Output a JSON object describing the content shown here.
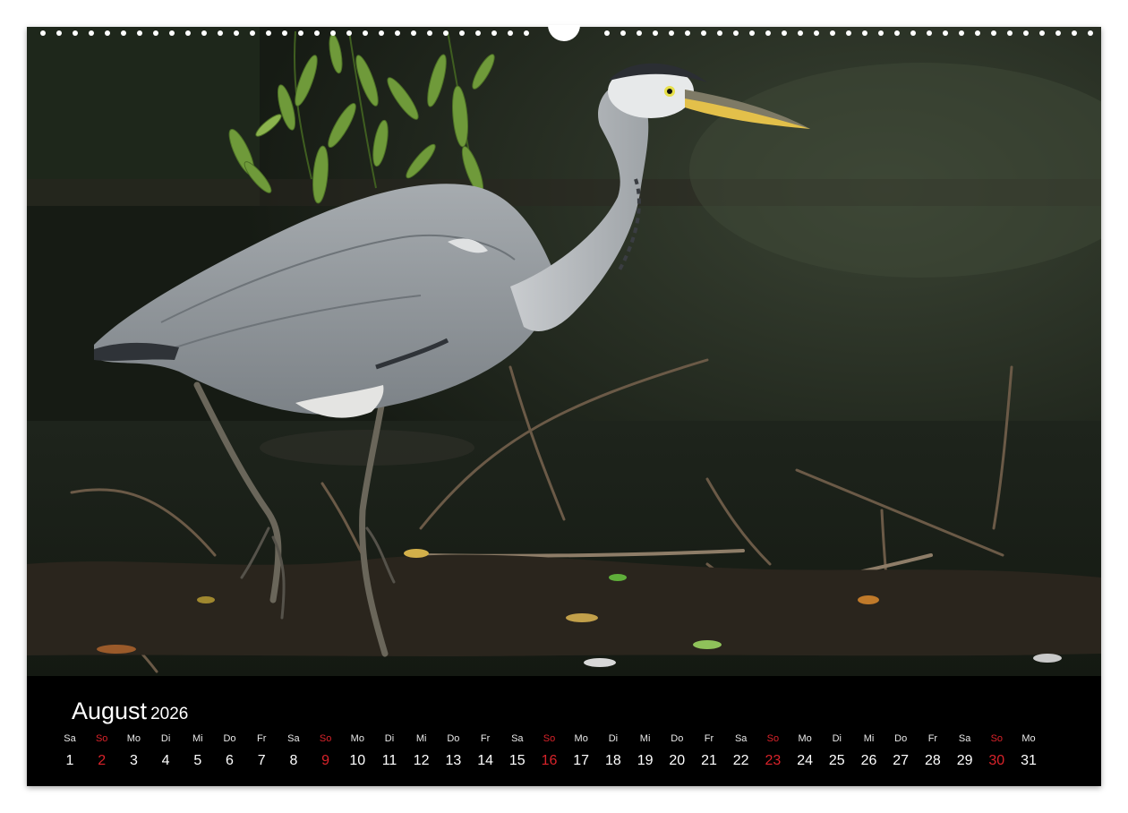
{
  "calendar": {
    "month": "August",
    "year": "2026",
    "weekend_color": "#d9232a",
    "days": [
      {
        "name": "Sa",
        "num": "1",
        "sunday": false
      },
      {
        "name": "So",
        "num": "2",
        "sunday": true
      },
      {
        "name": "Mo",
        "num": "3",
        "sunday": false
      },
      {
        "name": "Di",
        "num": "4",
        "sunday": false
      },
      {
        "name": "Mi",
        "num": "5",
        "sunday": false
      },
      {
        "name": "Do",
        "num": "6",
        "sunday": false
      },
      {
        "name": "Fr",
        "num": "7",
        "sunday": false
      },
      {
        "name": "Sa",
        "num": "8",
        "sunday": false
      },
      {
        "name": "So",
        "num": "9",
        "sunday": true
      },
      {
        "name": "Mo",
        "num": "10",
        "sunday": false
      },
      {
        "name": "Di",
        "num": "11",
        "sunday": false
      },
      {
        "name": "Mi",
        "num": "12",
        "sunday": false
      },
      {
        "name": "Do",
        "num": "13",
        "sunday": false
      },
      {
        "name": "Fr",
        "num": "14",
        "sunday": false
      },
      {
        "name": "Sa",
        "num": "15",
        "sunday": false
      },
      {
        "name": "So",
        "num": "16",
        "sunday": true
      },
      {
        "name": "Mo",
        "num": "17",
        "sunday": false
      },
      {
        "name": "Di",
        "num": "18",
        "sunday": false
      },
      {
        "name": "Mi",
        "num": "19",
        "sunday": false
      },
      {
        "name": "Do",
        "num": "20",
        "sunday": false
      },
      {
        "name": "Fr",
        "num": "21",
        "sunday": false
      },
      {
        "name": "Sa",
        "num": "22",
        "sunday": false
      },
      {
        "name": "So",
        "num": "23",
        "sunday": true
      },
      {
        "name": "Mo",
        "num": "24",
        "sunday": false
      },
      {
        "name": "Di",
        "num": "25",
        "sunday": false
      },
      {
        "name": "Mi",
        "num": "26",
        "sunday": false
      },
      {
        "name": "Do",
        "num": "27",
        "sunday": false
      },
      {
        "name": "Fr",
        "num": "28",
        "sunday": false
      },
      {
        "name": "Sa",
        "num": "29",
        "sunday": false
      },
      {
        "name": "So",
        "num": "30",
        "sunday": true
      },
      {
        "name": "Mo",
        "num": "31",
        "sunday": false
      }
    ]
  },
  "photo": {
    "subject": "grey-heron"
  }
}
